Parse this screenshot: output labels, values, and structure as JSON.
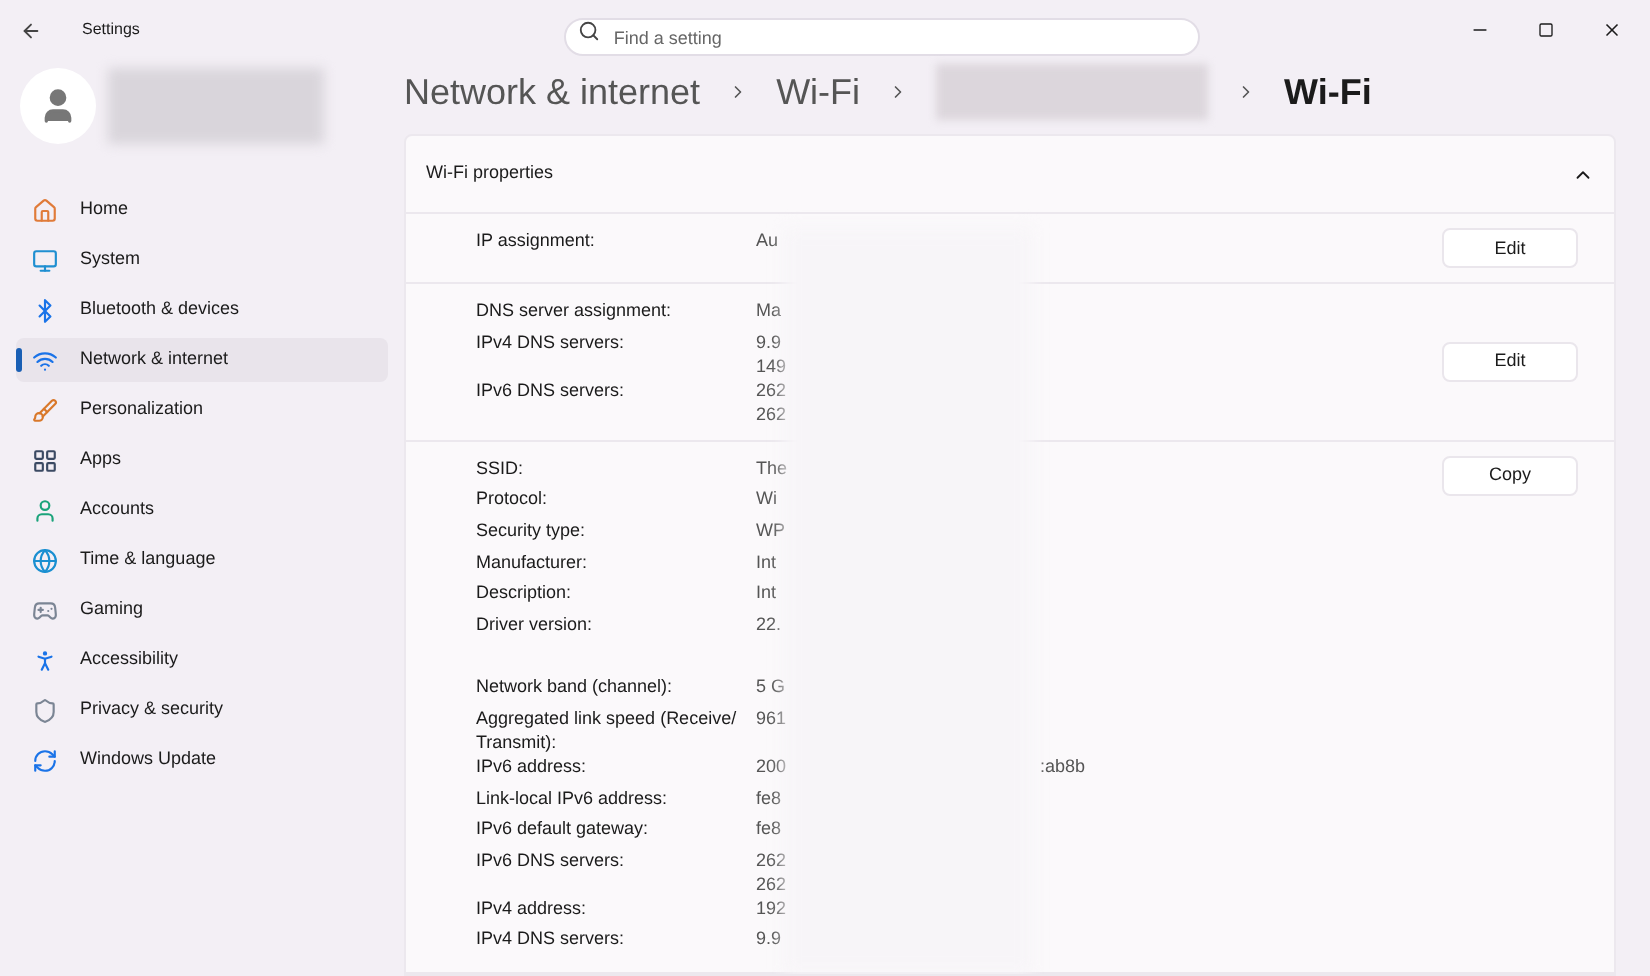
{
  "window": {
    "title": "Settings"
  },
  "search": {
    "placeholder": "Find a setting"
  },
  "breadcrumb": [
    "Network & internet",
    "Wi-Fi",
    "Wi-Fi"
  ],
  "sidebar": {
    "items": [
      {
        "label": "Home",
        "selected": false
      },
      {
        "label": "System",
        "selected": false
      },
      {
        "label": "Bluetooth & devices",
        "selected": false
      },
      {
        "label": "Network & internet",
        "selected": true
      },
      {
        "label": "Personalization",
        "selected": false
      },
      {
        "label": "Apps",
        "selected": false
      },
      {
        "label": "Accounts",
        "selected": false
      },
      {
        "label": "Time & language",
        "selected": false
      },
      {
        "label": "Gaming",
        "selected": false
      },
      {
        "label": "Accessibility",
        "selected": false
      },
      {
        "label": "Privacy & security",
        "selected": false
      },
      {
        "label": "Windows Update",
        "selected": false
      }
    ]
  },
  "card": {
    "title": "Wi-Fi properties",
    "expanded": true,
    "groups": [
      {
        "button": "Edit",
        "sections": [
          [
            {
              "label": "IP assignment:",
              "value": [
                "Au"
              ]
            }
          ]
        ]
      },
      {
        "button": "Edit",
        "sections": [
          [
            {
              "label": "DNS server assignment:",
              "value": [
                "Ma"
              ]
            },
            {
              "label": "IPv4 DNS servers:",
              "value": [
                "9.9",
                "149"
              ]
            },
            {
              "label": "IPv6 DNS servers:",
              "value": [
                "262",
                "262"
              ]
            }
          ]
        ]
      },
      {
        "button": "Copy",
        "sections": [
          [
            {
              "label": "SSID:",
              "value": [
                "The"
              ]
            },
            {
              "label": "Protocol:",
              "value": [
                "Wi"
              ]
            },
            {
              "label": "Security type:",
              "value": [
                "WP"
              ]
            },
            {
              "label": "Manufacturer:",
              "value": [
                "Int"
              ]
            },
            {
              "label": "Description:",
              "value": [
                "Int"
              ]
            },
            {
              "label": "Driver version:",
              "value": [
                "22."
              ]
            }
          ],
          [
            {
              "label": "Network band (channel):",
              "value": [
                "5 G"
              ]
            },
            {
              "label": "Aggregated link speed (Receive/ Transmit):",
              "value": [
                "961"
              ]
            },
            {
              "label": "IPv6 address:",
              "value": [
                "200"
              ],
              "tail": ":ab8b"
            },
            {
              "label": "Link-local IPv6 address:",
              "value": [
                "fe8"
              ]
            },
            {
              "label": "IPv6 default gateway:",
              "value": [
                "fe8"
              ]
            },
            {
              "label": "IPv6 DNS servers:",
              "value": [
                "262",
                "262"
              ]
            },
            {
              "label": "IPv4 address:",
              "value": [
                "192"
              ]
            },
            {
              "label": "IPv4 DNS servers:",
              "value": [
                "9.9"
              ]
            }
          ]
        ]
      }
    ]
  }
}
